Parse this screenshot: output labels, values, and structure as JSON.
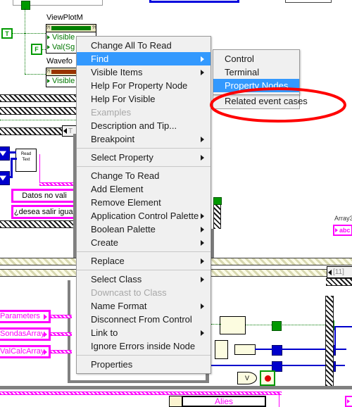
{
  "app": {
    "kind": "labview-block-diagram",
    "accent_highlight": "#3399fe",
    "annotation_color": "#ff0000",
    "wire_green": "#007700",
    "wire_blue": "#0000cc",
    "wire_magenta": "#ff00ff"
  },
  "diagram": {
    "property_nodes": [
      {
        "label": "ViewPlotM",
        "bar_color": "#008000",
        "rows": [
          "Visible",
          "Val(Sg"
        ]
      },
      {
        "label": "Wavefo",
        "bar_color": "#993300",
        "rows": [
          "Visible"
        ]
      }
    ],
    "constants": [
      {
        "name": "true-constant",
        "text": "T"
      },
      {
        "name": "false-constant",
        "text": "F"
      }
    ],
    "subvi": {
      "line1": "Read",
      "line2": "Text"
    },
    "string_constants": [
      "Datos no vali",
      "¿desea salir igual"
    ],
    "cluster_terminals": [
      "Parameters",
      "SondasArray",
      "ValCalcArray"
    ],
    "array3": {
      "label": "Array3",
      "terminal_text": "abc"
    },
    "case_selector": {
      "value": "[11]"
    },
    "bottom_label": "Alies"
  },
  "context_menu": {
    "items": [
      {
        "label": "Change All To Read",
        "submenu": false,
        "enabled": true,
        "selected": false
      },
      {
        "label": "Find",
        "submenu": true,
        "enabled": true,
        "selected": true
      },
      {
        "label": "Visible Items",
        "submenu": true,
        "enabled": true,
        "selected": false
      },
      {
        "label": "Help For Property Node",
        "submenu": false,
        "enabled": true,
        "selected": false
      },
      {
        "label": "Help For Visible",
        "submenu": false,
        "enabled": true,
        "selected": false
      },
      {
        "label": "Examples",
        "submenu": false,
        "enabled": false,
        "selected": false
      },
      {
        "label": "Description and Tip...",
        "submenu": false,
        "enabled": true,
        "selected": false
      },
      {
        "label": "Breakpoint",
        "submenu": true,
        "enabled": true,
        "selected": false
      },
      {
        "separator": true
      },
      {
        "label": "Select Property",
        "submenu": true,
        "enabled": true,
        "selected": false
      },
      {
        "separator": true
      },
      {
        "label": "Change To Read",
        "submenu": false,
        "enabled": true,
        "selected": false
      },
      {
        "label": "Add Element",
        "submenu": false,
        "enabled": true,
        "selected": false
      },
      {
        "label": "Remove Element",
        "submenu": false,
        "enabled": true,
        "selected": false
      },
      {
        "label": "Application Control Palette",
        "submenu": true,
        "enabled": true,
        "selected": false
      },
      {
        "label": "Boolean Palette",
        "submenu": true,
        "enabled": true,
        "selected": false
      },
      {
        "label": "Create",
        "submenu": true,
        "enabled": true,
        "selected": false
      },
      {
        "separator": true
      },
      {
        "label": "Replace",
        "submenu": true,
        "enabled": true,
        "selected": false
      },
      {
        "separator": true
      },
      {
        "label": "Select Class",
        "submenu": true,
        "enabled": true,
        "selected": false
      },
      {
        "label": "Downcast to Class",
        "submenu": false,
        "enabled": false,
        "selected": false
      },
      {
        "label": "Name Format",
        "submenu": true,
        "enabled": true,
        "selected": false
      },
      {
        "label": "Disconnect From Control",
        "submenu": false,
        "enabled": true,
        "selected": false
      },
      {
        "label": "Link to",
        "submenu": true,
        "enabled": true,
        "selected": false
      },
      {
        "label": "Ignore Errors inside Node",
        "submenu": false,
        "enabled": true,
        "selected": false
      },
      {
        "separator": true
      },
      {
        "label": "Properties",
        "submenu": false,
        "enabled": true,
        "selected": false
      }
    ]
  },
  "find_submenu": {
    "items": [
      {
        "label": "Control",
        "selected": false
      },
      {
        "label": "Terminal",
        "selected": false
      },
      {
        "label": "Property Nodes",
        "selected": true
      }
    ],
    "trailing_item": {
      "label": "Related event cases",
      "annotated": true
    }
  },
  "annotation": {
    "shape": "ellipse",
    "color": "#ff0000",
    "target": "Related event cases"
  }
}
